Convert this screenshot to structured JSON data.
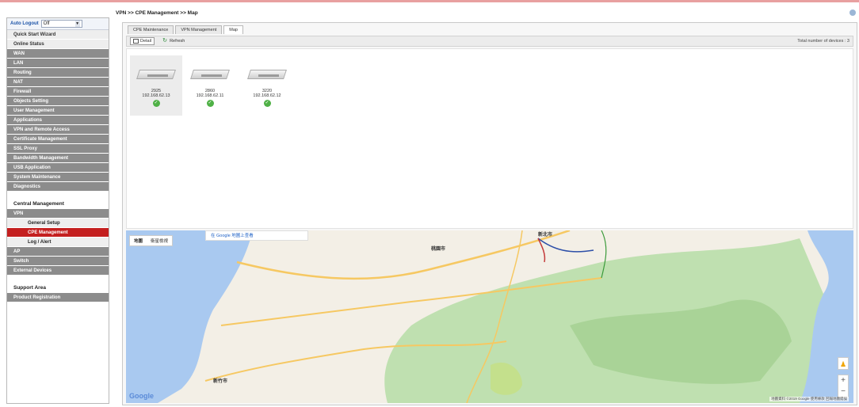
{
  "breadcrumb": "VPN >> CPE Management >> Map",
  "sidebar": {
    "auto_logout_label": "Auto Logout",
    "auto_logout_value": "Off",
    "items": [
      {
        "label": "Quick Start Wizard",
        "style": "light"
      },
      {
        "label": "Online Status",
        "style": "light"
      },
      {
        "label": "WAN",
        "style": "dark"
      },
      {
        "label": "LAN",
        "style": "dark"
      },
      {
        "label": "Routing",
        "style": "dark"
      },
      {
        "label": "NAT",
        "style": "dark"
      },
      {
        "label": "Firewall",
        "style": "dark"
      },
      {
        "label": "Objects Setting",
        "style": "dark"
      },
      {
        "label": "User Management",
        "style": "dark"
      },
      {
        "label": "Applications",
        "style": "dark"
      },
      {
        "label": "VPN and Remote Access",
        "style": "dark"
      },
      {
        "label": "Certificate Management",
        "style": "dark"
      },
      {
        "label": "SSL Proxy",
        "style": "dark"
      },
      {
        "label": "Bandwidth Management",
        "style": "dark"
      },
      {
        "label": "USB Application",
        "style": "dark"
      },
      {
        "label": "System Maintenance",
        "style": "dark"
      },
      {
        "label": "Diagnostics",
        "style": "dark"
      }
    ],
    "central_title": "Central Management",
    "central_items": [
      {
        "label": "VPN",
        "style": "dark"
      },
      {
        "label": "General Setup",
        "style": "sub"
      },
      {
        "label": "CPE Management",
        "style": "active"
      },
      {
        "label": "Log / Alert",
        "style": "sub"
      },
      {
        "label": "AP",
        "style": "dark"
      },
      {
        "label": "Switch",
        "style": "dark"
      },
      {
        "label": "External Devices",
        "style": "dark"
      }
    ],
    "support_title": "Support Area",
    "support_items": [
      {
        "label": "Product Registration",
        "style": "dark"
      }
    ]
  },
  "tabs": [
    "CPE Maintenance",
    "VPN Management",
    "Map"
  ],
  "selected_tab": "Map",
  "toolbar": {
    "detail_label": "Detail",
    "refresh_label": "Refresh",
    "total_devices": "Total number of devices : 3"
  },
  "devices": [
    {
      "model": "2925",
      "ip": "192.168.62.13"
    },
    {
      "model": "2860",
      "ip": "192.168.62.11"
    },
    {
      "model": "3220",
      "ip": "192.168.62.12"
    }
  ],
  "map": {
    "view_map": "地圖",
    "view_satellite": "衛星檢視",
    "google_link": "在 Google 地圖上查看",
    "cities": [
      "桃園市",
      "新竹市",
      "新北市"
    ],
    "logo": "Google",
    "attribution": "地圖資料 ©2019 Google   使用條款   回報地圖錯誤",
    "zoom_in": "+",
    "zoom_out": "−",
    "colors": {
      "sea": "#a9c9f0",
      "land": "#f3efe6",
      "forest": "#bfe0b0",
      "road": "#f6c862"
    }
  }
}
